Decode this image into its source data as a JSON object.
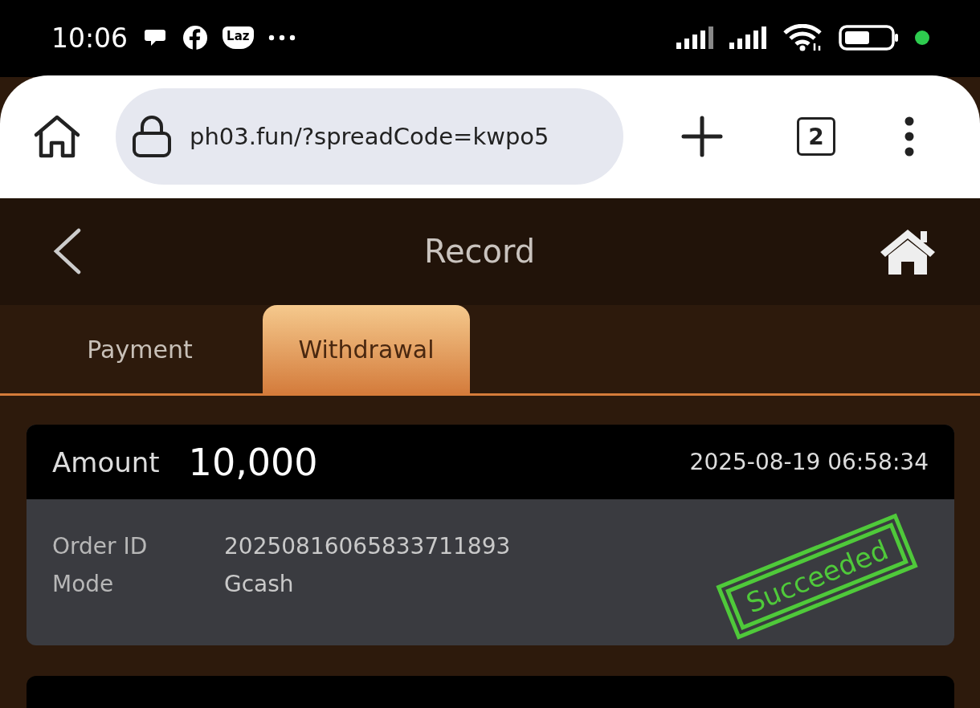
{
  "status_bar": {
    "time": "10:06",
    "badge_text": "Laz"
  },
  "browser": {
    "url": "ph03.fun/?spreadCode=kwpo5",
    "tab_count": "2"
  },
  "header": {
    "title": "Record"
  },
  "tabs": [
    {
      "label": "Payment",
      "selected": false
    },
    {
      "label": "Withdrawal",
      "selected": true
    }
  ],
  "records": [
    {
      "amount_label": "Amount",
      "amount": "10,000",
      "datetime": "2025-08-19 06:58:34",
      "fields": [
        {
          "label": "Order ID",
          "value": "20250816065833711893"
        },
        {
          "label": "Mode",
          "value": "Gcash"
        }
      ],
      "status": {
        "kind": "succeeded",
        "label": "Succeeded"
      }
    }
  ]
}
